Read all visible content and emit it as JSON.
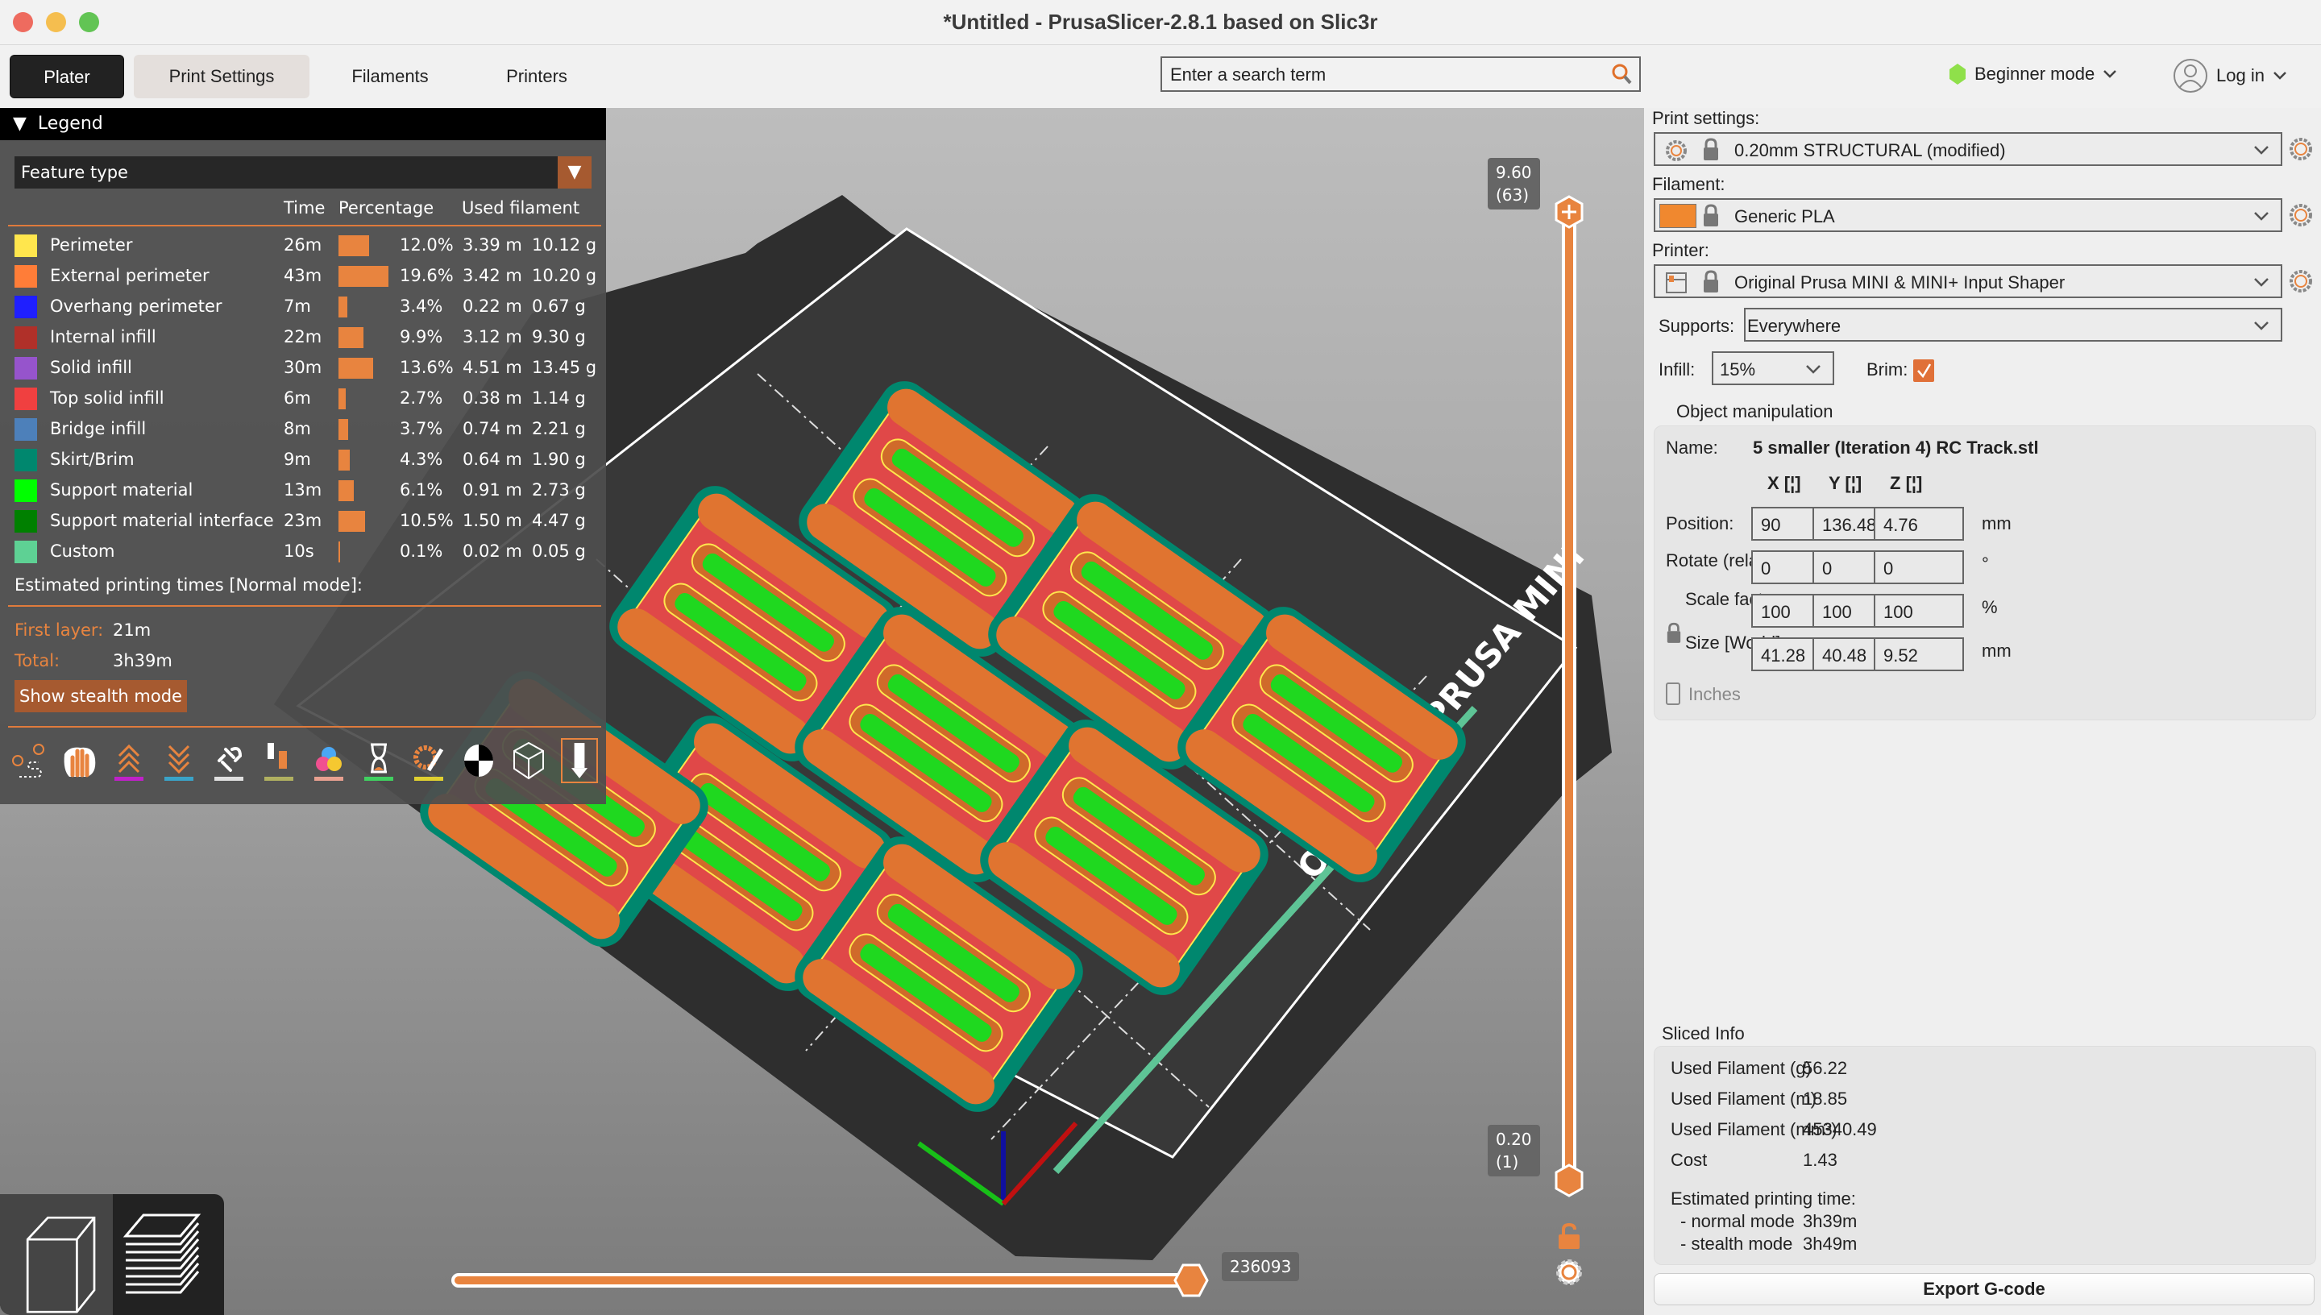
{
  "window": {
    "title": "*Untitled - PrusaSlicer-2.8.1 based on Slic3r",
    "controls": [
      "close",
      "minimize",
      "zoom"
    ]
  },
  "tabs": [
    {
      "label": "Plater",
      "state": "active"
    },
    {
      "label": "Print Settings",
      "state": "hover"
    },
    {
      "label": "Filaments",
      "state": "normal"
    },
    {
      "label": "Printers",
      "state": "normal"
    }
  ],
  "search": {
    "placeholder": "Enter a search term"
  },
  "mode": {
    "label": "Beginner mode",
    "color": "#8fe04a"
  },
  "login": {
    "label": "Log in"
  },
  "legend": {
    "title": "Legend",
    "view_type": "Feature type",
    "headers": {
      "time": "Time",
      "percentage": "Percentage",
      "used_filament": "Used filament"
    },
    "rows": [
      {
        "name": "Perimeter",
        "color": "#ffe64d",
        "time": "26m",
        "pct": 12.0,
        "pct_label": "12.0%",
        "meters": "3.39 m",
        "grams": "10.12 g"
      },
      {
        "name": "External perimeter",
        "color": "#ff7d38",
        "time": "43m",
        "pct": 19.6,
        "pct_label": "19.6%",
        "meters": "3.42 m",
        "grams": "10.20 g"
      },
      {
        "name": "Overhang perimeter",
        "color": "#1f1fff",
        "time": "7m",
        "pct": 3.4,
        "pct_label": "3.4%",
        "meters": "0.22 m",
        "grams": "0.67 g"
      },
      {
        "name": "Internal infill",
        "color": "#b03029",
        "time": "22m",
        "pct": 9.9,
        "pct_label": "9.9%",
        "meters": "3.12 m",
        "grams": "9.30 g"
      },
      {
        "name": "Solid infill",
        "color": "#9654cc",
        "time": "30m",
        "pct": 13.6,
        "pct_label": "13.6%",
        "meters": "4.51 m",
        "grams": "13.45 g"
      },
      {
        "name": "Top solid infill",
        "color": "#f04040",
        "time": "6m",
        "pct": 2.7,
        "pct_label": "2.7%",
        "meters": "0.38 m",
        "grams": "1.14 g"
      },
      {
        "name": "Bridge infill",
        "color": "#4d80ba",
        "time": "8m",
        "pct": 3.7,
        "pct_label": "3.7%",
        "meters": "0.74 m",
        "grams": "2.21 g"
      },
      {
        "name": "Skirt/Brim",
        "color": "#00876e",
        "time": "9m",
        "pct": 4.3,
        "pct_label": "4.3%",
        "meters": "0.64 m",
        "grams": "1.90 g"
      },
      {
        "name": "Support material",
        "color": "#00ff00",
        "time": "13m",
        "pct": 6.1,
        "pct_label": "6.1%",
        "meters": "0.91 m",
        "grams": "2.73 g"
      },
      {
        "name": "Support material interface",
        "color": "#008000",
        "time": "23m",
        "pct": 10.5,
        "pct_label": "10.5%",
        "meters": "1.50 m",
        "grams": "4.47 g"
      },
      {
        "name": "Custom",
        "color": "#5ed194",
        "time": "10s",
        "pct": 0.1,
        "pct_label": "0.1%",
        "meters": "0.02 m",
        "grams": "0.05 g"
      }
    ],
    "estimated_title": "Estimated printing times [Normal mode]:",
    "first_layer_label": "First layer:",
    "first_layer_value": "21m",
    "total_label": "Total:",
    "total_value": "3h39m",
    "stealth_button": "Show stealth mode",
    "toolbar_icons": [
      "travel-icon",
      "wipe-icon",
      "retractions-icon",
      "deretractions-icon",
      "seams-icon",
      "tool-changes-icon",
      "color-changes-icon",
      "pause-prints-icon",
      "custom-gcode-icon",
      "center-of-gravity-icon",
      "shells-icon",
      "tool-marker-icon"
    ]
  },
  "vertical_slider": {
    "top_value": "9.60",
    "top_layer": "(63)",
    "bottom_value": "0.20",
    "bottom_layer": "(1)",
    "top_fraction": 1.0,
    "bottom_fraction": 0.0
  },
  "horizontal_slider": {
    "value": "236093",
    "fraction": 1.0
  },
  "bed": {
    "label": "ORIGINAL PRUSA MINI"
  },
  "sidebar": {
    "print_settings_label": "Print settings:",
    "print_settings_value": "0.20mm STRUCTURAL (modified)",
    "filament_label": "Filament:",
    "filament_value": "Generic PLA",
    "filament_color": "#f0882f",
    "printer_label": "Printer:",
    "printer_value": "Original Prusa MINI & MINI+ Input Shaper",
    "supports_label": "Supports:",
    "supports_value": "Everywhere",
    "infill_label": "Infill:",
    "infill_value": "15%",
    "brim_label": "Brim:",
    "brim_checked": true,
    "object_manipulation": {
      "title": "Object manipulation",
      "name_label": "Name:",
      "name_value": "5 smaller (Iteration 4) RC Track.stl",
      "axes": [
        "X",
        "Y",
        "Z"
      ],
      "position_label": "Position:",
      "position": [
        "90",
        "136.48",
        "4.76"
      ],
      "position_unit": "mm",
      "rotate_label": "Rotate (relative):",
      "rotate": [
        "0",
        "0",
        "0"
      ],
      "rotate_unit": "°",
      "scale_label": "Scale factors:",
      "scale": [
        "100",
        "100",
        "100"
      ],
      "scale_unit": "%",
      "size_label": "Size [World]:",
      "size": [
        "41.28",
        "40.48",
        "9.52"
      ],
      "size_unit": "mm",
      "inches_label": "Inches",
      "inches_checked": false
    },
    "sliced_info": {
      "title": "Sliced Info",
      "rows": [
        {
          "label": "Used Filament (g)",
          "value": "56.22"
        },
        {
          "label": "Used Filament (m)",
          "value": "18.85"
        },
        {
          "label": "Used Filament (mm³)",
          "value": "45340.49"
        },
        {
          "label": "Cost",
          "value": "1.43"
        }
      ],
      "est_label": "Estimated printing time:",
      "normal_label": "- normal mode",
      "normal_value": "3h39m",
      "stealth_label": "- stealth mode",
      "stealth_value": "3h49m"
    },
    "export_button": "Export G-code"
  },
  "colors": {
    "accent": "#e8843f",
    "dark_accent": "#a65a30"
  }
}
